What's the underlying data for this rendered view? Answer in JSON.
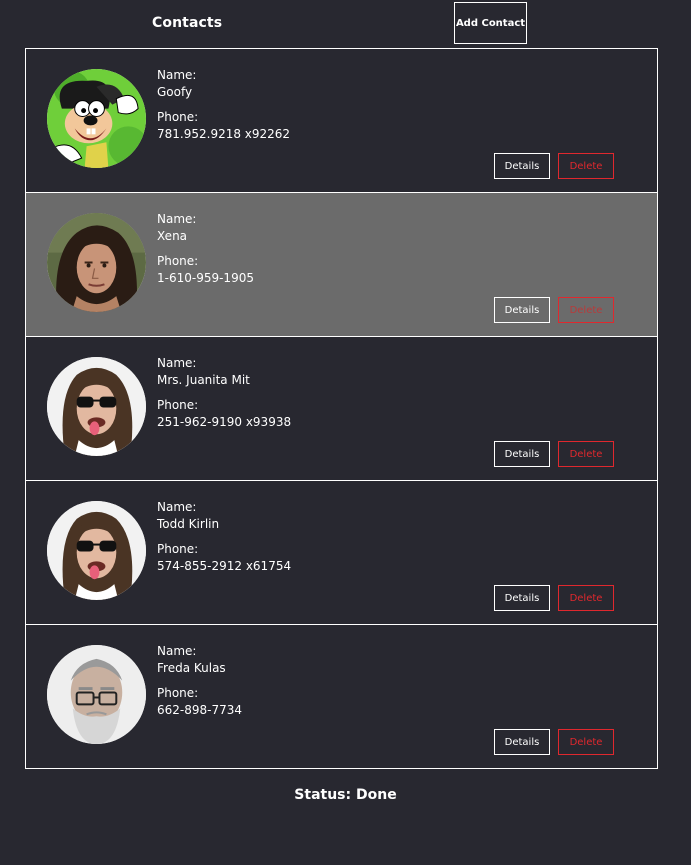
{
  "header": {
    "title": "Contacts",
    "add_contact_label": "Add Contact"
  },
  "contacts": [
    {
      "name_label": "Name:",
      "name": "Goofy",
      "phone_label": "Phone:",
      "phone": "781.952.9218 x92262",
      "details_label": "Details",
      "delete_label": "Delete",
      "avatar": "goofy-cartoon",
      "selected": false
    },
    {
      "name_label": "Name:",
      "name": "Xena",
      "phone_label": "Phone:",
      "phone": "1-610-959-1905",
      "details_label": "Details",
      "delete_label": "Delete",
      "avatar": "woman-portrait",
      "selected": true
    },
    {
      "name_label": "Name:",
      "name": "Mrs. Juanita Mit",
      "phone_label": "Phone:",
      "phone": "251-962-9190 x93938",
      "details_label": "Details",
      "delete_label": "Delete",
      "avatar": "man-sunglasses",
      "selected": false
    },
    {
      "name_label": "Name:",
      "name": "Todd Kirlin",
      "phone_label": "Phone:",
      "phone": "574-855-2912 x61754",
      "details_label": "Details",
      "delete_label": "Delete",
      "avatar": "man-sunglasses",
      "selected": false
    },
    {
      "name_label": "Name:",
      "name": "Freda Kulas",
      "phone_label": "Phone:",
      "phone": "662-898-7734",
      "details_label": "Details",
      "delete_label": "Delete",
      "avatar": "old-man-glasses",
      "selected": false
    }
  ],
  "status": {
    "text": "Status: Done"
  },
  "colors": {
    "background": "#282830",
    "selected_row": "#6b6b6b",
    "delete_red": "#e0282e",
    "border": "#ffffff"
  }
}
